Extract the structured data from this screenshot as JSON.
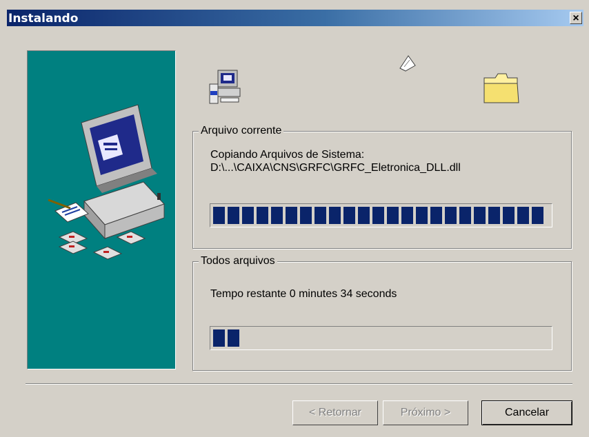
{
  "window": {
    "title": "Instalando",
    "close_glyph": "×"
  },
  "icons": {
    "computer": "install-computer-icon",
    "floppies": "floppy-disks-icon",
    "source": "source-computer-icon",
    "flying_page": "flying-page-icon",
    "folder": "destination-folder-icon",
    "close": "close-icon"
  },
  "current_file": {
    "label": "Arquivo corrente",
    "action": "Copiando Arquivos de Sistema:",
    "path": "D:\\...\\CAIXA\\CNS\\GRFC\\GRFC_Eletronica_DLL.dll",
    "progress": 1.0
  },
  "all_files": {
    "label": "Todos arquivos",
    "remaining": "Tempo restante 0 minutes 34 seconds",
    "progress": 0.08
  },
  "buttons": {
    "back": "< Retornar",
    "next": "Próximo >",
    "cancel": "Cancelar"
  },
  "colors": {
    "accent": "#0a246a",
    "panel": "#008080",
    "face": "#d4d0c8"
  }
}
